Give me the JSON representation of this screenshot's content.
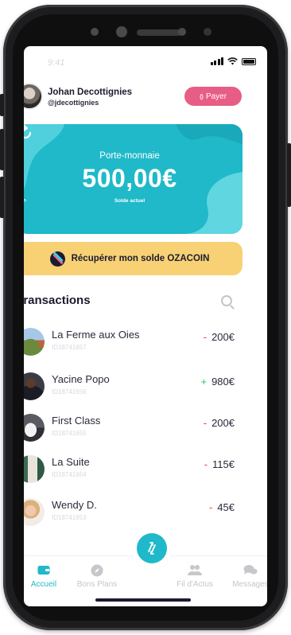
{
  "status_bar": {
    "time": "9:41"
  },
  "header": {
    "user_name": "Johan Decottignies",
    "user_handle": "@jdecottignies",
    "pay_label": "Payer",
    "nfc_symbol": "⦅⦆"
  },
  "wallet": {
    "title": "Porte-monnaie",
    "amount": "500,00€",
    "subtitle": "Solde actuel",
    "color": "#1fb9c9"
  },
  "recover": {
    "label": "Récupérer mon solde OZACOIN",
    "color": "#f8d175"
  },
  "transactions": {
    "title": "Transactions",
    "items": [
      {
        "name": "La Ferme aux Oies",
        "id": "ID18741657",
        "sign": "-",
        "amount": "200€",
        "type": "negative"
      },
      {
        "name": "Yacine Popo",
        "id": "ID18741656",
        "sign": "+",
        "amount": "980€",
        "type": "positive"
      },
      {
        "name": "First Class",
        "id": "ID18741655",
        "sign": "-",
        "amount": "200€",
        "type": "negative"
      },
      {
        "name": "La Suite",
        "id": "ID18741654",
        "sign": "-",
        "amount": "115€",
        "type": "negative"
      },
      {
        "name": "Wendy D.",
        "id": "ID18741653",
        "sign": "-",
        "amount": "45€",
        "type": "negative"
      }
    ]
  },
  "nav": {
    "items": [
      {
        "label": "Accueil",
        "icon": "wallet-icon",
        "active": true
      },
      {
        "label": "Bons Plans",
        "icon": "compass-icon",
        "active": false
      },
      {
        "label": "Fil d'Actus",
        "icon": "people-icon",
        "active": false
      },
      {
        "label": "Messages",
        "icon": "chat-icon",
        "active": false
      }
    ],
    "fab_icon": "transfer-icon"
  },
  "colors": {
    "accent": "#1fb9c9",
    "pay": "#e85d85",
    "negative": "#ea3b47",
    "positive": "#36c36c"
  }
}
